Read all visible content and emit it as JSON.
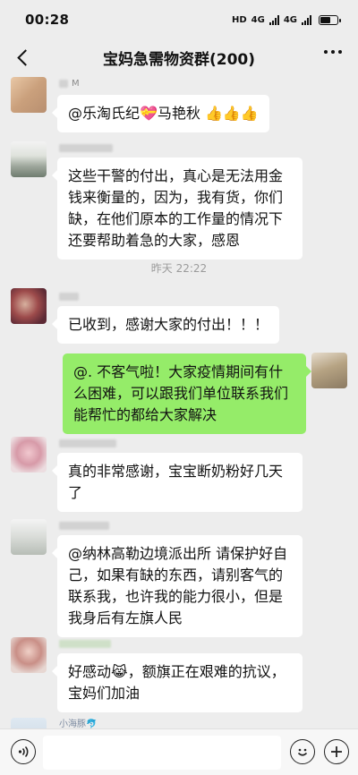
{
  "status_bar": {
    "time": "00:28",
    "hd": "HD",
    "net1": "4G",
    "net2": "4G"
  },
  "title_bar": {
    "title": "宝妈急需物资群(200)"
  },
  "messages": [
    {
      "sender": "M",
      "text": "@乐淘氏纪💝马艳秋 👍👍👍"
    },
    {
      "sender": "",
      "text": "这些干警的付出，真心是无法用金钱来衡量的，因为，我有货，你们缺，在他们原本的工作量的情况下还要帮助着急的大家，感恩"
    },
    {
      "sender": "",
      "text": "已收到，感谢大家的付出！！！"
    },
    {
      "sender": "",
      "text": "@. 不客气啦！大家疫情期间有什么困难，可以跟我们单位联系我们能帮忙的都给大家解决"
    },
    {
      "sender": "",
      "text": "真的非常感谢，宝宝断奶粉好几天了"
    },
    {
      "sender": "",
      "text": "@纳林高勒边境派出所 请保护好自己，如果有缺的东西，请别客气的联系我，也许我的能力很小，但是我身后有左旗人民"
    },
    {
      "sender": "",
      "text": "好感动😹，额旗正在艰难的抗议，宝妈们加油"
    },
    {
      "sender": "小海豚🐬",
      "text": ""
    }
  ],
  "timestamp": "昨天 22:22",
  "icons": {
    "back": "back-arrow-icon",
    "more": "more-dots-icon",
    "voice": "voice-icon",
    "emoji": "emoji-icon",
    "plus": "plus-icon"
  },
  "colors": {
    "outgoing_bubble": "#95ec69",
    "incoming_bubble": "#ffffff",
    "background": "#ededed"
  }
}
